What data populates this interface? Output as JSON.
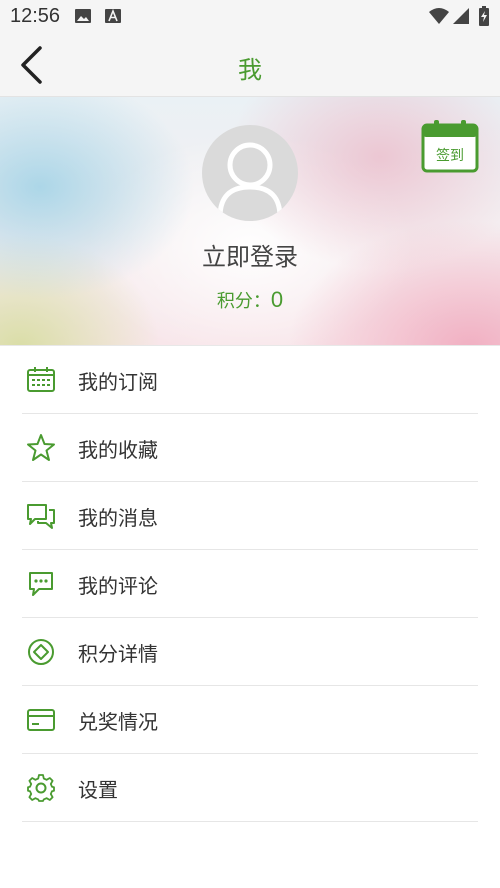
{
  "status_bar": {
    "time": "12:56",
    "icons": [
      "image-icon",
      "font-a-icon",
      "wifi-icon",
      "signal-icon",
      "battery-icon"
    ]
  },
  "header": {
    "title": "我",
    "back_icon": "chevron-left-icon"
  },
  "profile": {
    "login_text": "立即登录",
    "points_label": "积分：",
    "points_value": "0",
    "checkin_label": "签到",
    "avatar_icon": "user-icon"
  },
  "menu": {
    "items": [
      {
        "label": "我的订阅",
        "icon": "calendar-icon"
      },
      {
        "label": "我的收藏",
        "icon": "star-icon"
      },
      {
        "label": "我的消息",
        "icon": "chat-bubbles-icon"
      },
      {
        "label": "我的评论",
        "icon": "comment-icon"
      },
      {
        "label": "积分详情",
        "icon": "points-icon"
      },
      {
        "label": "兑奖情况",
        "icon": "card-icon"
      },
      {
        "label": "设置",
        "icon": "gear-icon"
      }
    ]
  },
  "colors": {
    "accent": "#4a9b30",
    "text": "#333333",
    "divider": "#e6e6e6"
  }
}
